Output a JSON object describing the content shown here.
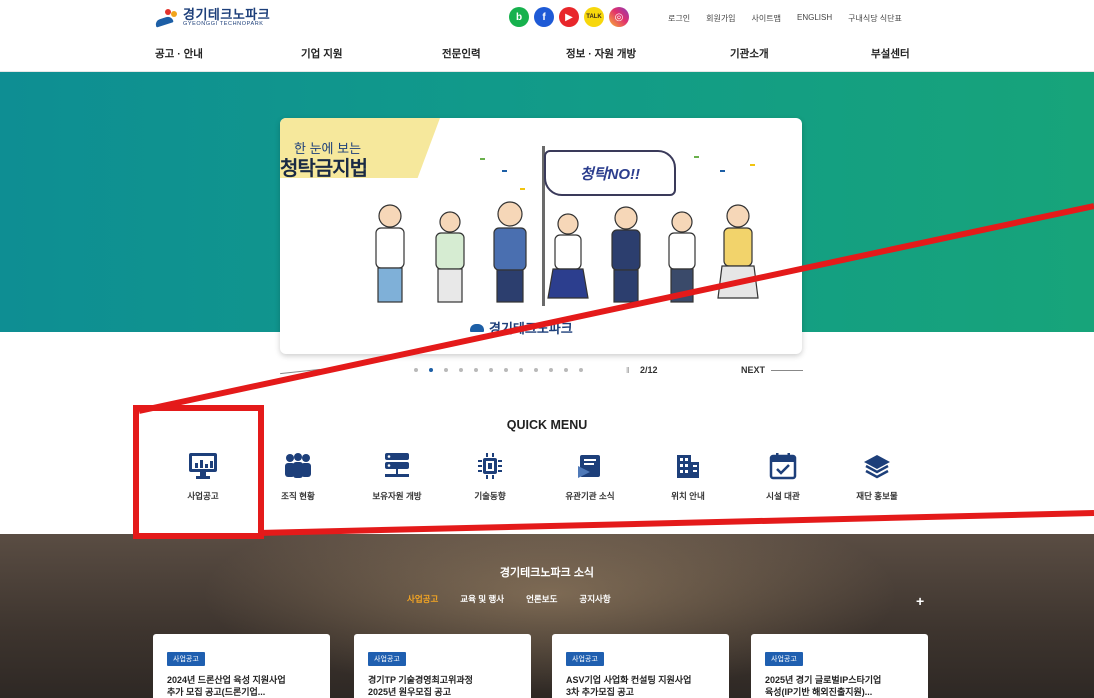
{
  "logo": {
    "kr": "경기테크노파크",
    "en": "GYEONGGI TECHNOPARK"
  },
  "social": [
    {
      "name": "blog-icon",
      "glyph": "b"
    },
    {
      "name": "facebook-icon",
      "glyph": "f"
    },
    {
      "name": "youtube-icon",
      "glyph": "▶"
    },
    {
      "name": "kakao-icon",
      "glyph": "TALK"
    },
    {
      "name": "instagram-icon",
      "glyph": "◎"
    }
  ],
  "util_links": [
    "로그인",
    "회원가입",
    "사이트맵",
    "ENGLISH",
    "구내식당 식단표"
  ],
  "gnb": [
    "공고 · 안내",
    "기업 지원",
    "전문인력",
    "정보 · 자원 개방",
    "기관소개",
    "부설센터"
  ],
  "hero": {
    "small_title": "한 눈에 보는",
    "title": "청탁금지법",
    "flag": "청탁NO!!",
    "card_logo": "경기테크노파크",
    "page": "2/12",
    "next": "NEXT",
    "pause": "II"
  },
  "quick_menu": {
    "title": "QUICK MENU",
    "items": [
      "사업공고",
      "조직 현황",
      "보유자원 개방",
      "기술동향",
      "유관기관 소식",
      "위치 안내",
      "시설 대관",
      "재단 홍보물"
    ]
  },
  "news": {
    "title": "경기테크노파크 소식",
    "tabs": [
      "사업공고",
      "교육 및 행사",
      "언론보도",
      "공지사항"
    ],
    "plus": "+",
    "cards": [
      {
        "badge": "사업공고",
        "line1": "2024년 드론산업 육성 지원사업",
        "line2": "추가 모집 공고(드론기업..."
      },
      {
        "badge": "사업공고",
        "line1": "경기TP 기술경영최고위과정",
        "line2": "2025년 원우모집 공고"
      },
      {
        "badge": "사업공고",
        "line1": "ASV기업 사업화 컨설팅 지원사업",
        "line2": "3차 추가모집 공고"
      },
      {
        "badge": "사업공고",
        "line1": "2025년 경기 글로벌IP스타기업",
        "line2": "육성(IP기반 해외진출지원)..."
      }
    ]
  },
  "colors": {
    "brand": "#1d3f7a",
    "accent": "#f5a623",
    "annotation": "#e41a1a",
    "hero_start": "#0e8e93",
    "hero_end": "#17a47a"
  }
}
